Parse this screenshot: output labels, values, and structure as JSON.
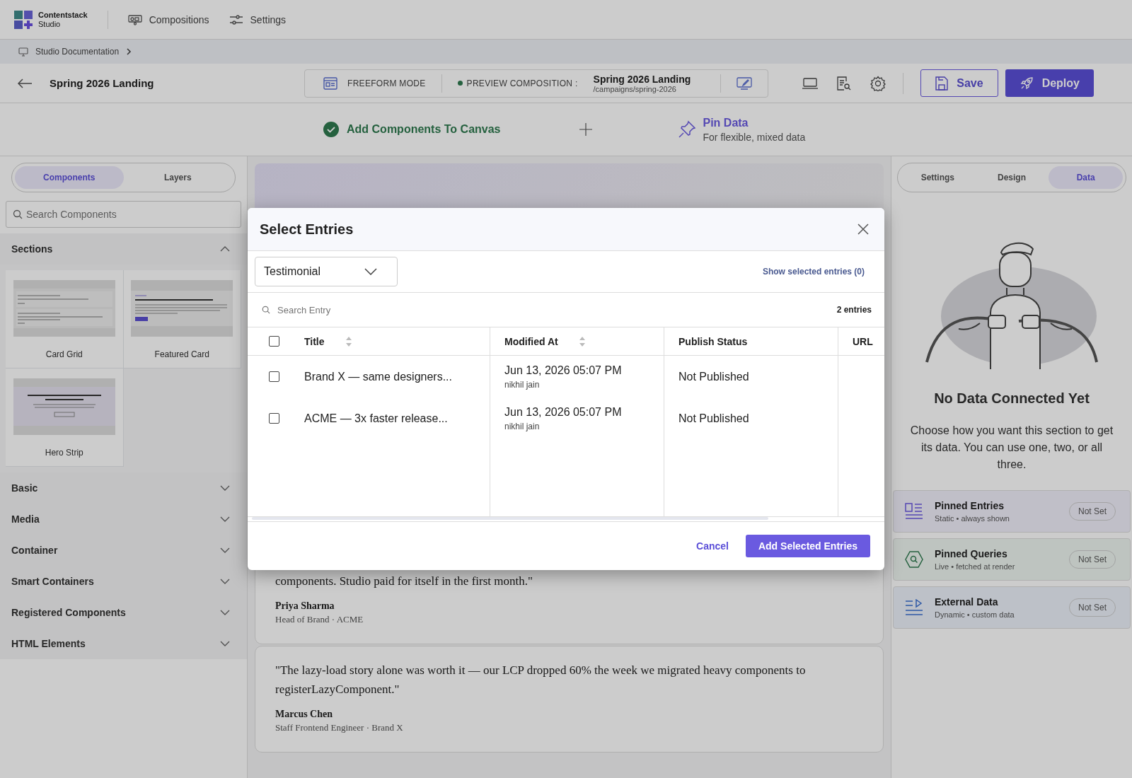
{
  "brand": {
    "name": "Contentstack",
    "product": "Studio"
  },
  "nav": [
    {
      "label": "Compositions",
      "kind": "compositions"
    },
    {
      "label": "Settings",
      "kind": "settings"
    }
  ],
  "breadcrumb": {
    "label": "Studio Documentation"
  },
  "header": {
    "title": "Spring 2026 Landing",
    "mode": "FREEFORM MODE",
    "preview_label": "PREVIEW COMPOSITION :",
    "preview_title": "Spring 2026 Landing",
    "preview_path": "/campaigns/spring-2026",
    "save": "Save",
    "deploy": "Deploy"
  },
  "steps": [
    {
      "title": "Add Components To Canvas",
      "done": true
    },
    {
      "title": "Pin Data",
      "subtitle": "For flexible, mixed data",
      "done": false
    }
  ],
  "left_panel": {
    "tabs": [
      {
        "label": "Components",
        "selected": true
      },
      {
        "label": "Layers",
        "selected": false
      }
    ],
    "search": {
      "placeholder": "Search Components"
    },
    "categories": [
      {
        "label": "Sections",
        "expanded": true,
        "items": [
          {
            "label": "Card Grid",
            "kind": "grid"
          },
          {
            "label": "Featured Card",
            "kind": "featured"
          },
          {
            "label": "Hero Strip",
            "kind": "hero"
          }
        ]
      },
      {
        "label": "Basic",
        "expanded": false
      },
      {
        "label": "Media",
        "expanded": false
      },
      {
        "label": "Container",
        "expanded": false
      },
      {
        "label": "Smart Containers",
        "expanded": false
      },
      {
        "label": "Registered Components",
        "expanded": false
      },
      {
        "label": "HTML Elements",
        "expanded": false
      }
    ]
  },
  "canvas": {
    "testimonials": [
      {
        "quote": "components. Studio paid for itself in the first month.\"",
        "name": "Priya Sharma",
        "role": "Head of Brand · ACME"
      },
      {
        "quote": "\"The lazy-load story alone was worth it — our LCP dropped 60% the week we migrated heavy components to registerLazyComponent.\"",
        "name": "Marcus Chen",
        "role": "Staff Frontend Engineer · Brand X"
      }
    ]
  },
  "right_panel": {
    "tabs": [
      {
        "label": "Settings",
        "selected": false
      },
      {
        "label": "Design",
        "selected": false
      },
      {
        "label": "Data",
        "selected": true
      }
    ],
    "empty_title": "No Data Connected Yet",
    "empty_text": "Choose how you want this section to get its data. You can use one, two, or all three.",
    "sources": [
      {
        "kind": "entries",
        "title": "Pinned Entries",
        "subtitle": "Static • always shown",
        "status": "Not Set"
      },
      {
        "kind": "queries",
        "title": "Pinned Queries",
        "subtitle": "Live • fetched at render",
        "status": "Not Set"
      },
      {
        "kind": "external",
        "title": "External Data",
        "subtitle": "Dynamic • custom data",
        "status": "Not Set"
      }
    ]
  },
  "modal": {
    "title": "Select Entries",
    "content_type": "Testimonial",
    "show_selected": "Show selected entries (0)",
    "search": {
      "placeholder": "Search Entry"
    },
    "count": "2 entries",
    "select_all": {
      "checked": false
    },
    "columns": [
      {
        "label": "Title",
        "sortable": true
      },
      {
        "label": "Modified At",
        "sortable": true
      },
      {
        "label": "Publish Status",
        "sortable": false
      },
      {
        "label": "URL",
        "sortable": false
      }
    ],
    "rows": [
      {
        "checked": false,
        "title": "Brand X — same designers...",
        "modified": "Jun 13, 2026 05:07 PM",
        "author": "nikhil jain",
        "status": "Not Published"
      },
      {
        "checked": false,
        "title": "ACME — 3x faster release...",
        "modified": "Jun 13, 2026 05:07 PM",
        "author": "nikhil jain",
        "status": "Not Published"
      }
    ],
    "cancel": "Cancel",
    "confirm": "Add Selected Entries"
  }
}
